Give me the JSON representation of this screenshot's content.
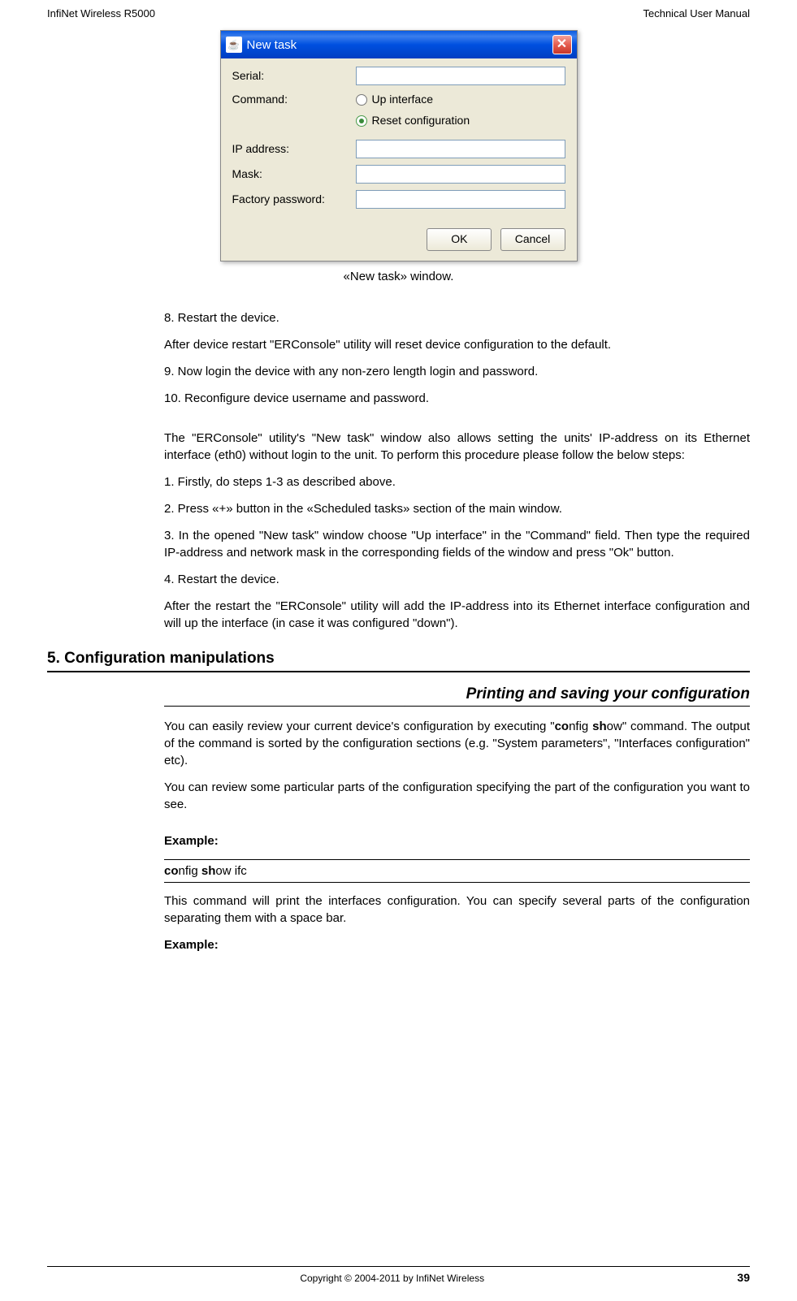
{
  "header": {
    "left": "InfiNet Wireless R5000",
    "right": "Technical User Manual"
  },
  "dialog": {
    "title": "New task",
    "serial_label": "Serial:",
    "command_label": "Command:",
    "up_interface": "Up interface",
    "reset_config": "Reset configuration",
    "ip_label": "IP address:",
    "mask_label": "Mask:",
    "factory_pw_label": "Factory password:",
    "ok": "OK",
    "cancel": "Cancel"
  },
  "caption": "«New task» window.",
  "body": {
    "p1": "8.  Restart the device.",
    "p2": "After device restart \"ERConsole\" utility will reset device configuration to the default.",
    "p3": "9.  Now login the device with any non-zero length login and password.",
    "p4": "10. Reconfigure device username and password.",
    "p5": "The \"ERConsole\" utility's \"New task\" window also allows setting the units' IP-address on its Ethernet interface (eth0) without login to the unit. To perform this procedure please follow the below steps:",
    "p6": "1. Firstly, do steps 1-3 as described above.",
    "p7": "2. Press «+» button in the «Scheduled tasks» section of the main window.",
    "p8": "3. In the opened \"New task\" window choose \"Up interface\" in the \"Command\" field. Then type the required IP-address and network mask in the corresponding fields of the window and press \"Ok\" button.",
    "p9": "4. Restart the device.",
    "p10": "After the restart the \"ERConsole\" utility will add the IP-address into its Ethernet interface configuration and will up the interface (in case it was configured \"down\")."
  },
  "section5": {
    "heading": "5. Configuration manipulations",
    "sub1": "Printing and saving your configuration",
    "p1a": "You can easily review your current device's configuration by executing \"",
    "p1b": "nfig ",
    "p1c": "ow\" command. The output of the command is sorted by the configuration sections (e.g. \"System parameters\", \"Interfaces configuration\" etc).",
    "p2": "You can review some particular parts of the configuration specifying the part of the configuration you want to see.",
    "example": "Example:",
    "code_co": "co",
    "code_nfig": "nfig ",
    "code_sh": "sh",
    "code_ow": "ow ifc",
    "p3": "This command will print the interfaces configuration. You can specify several parts of the configuration separating them with a space bar.",
    "example2": "Example:"
  },
  "footer": {
    "copyright": "Copyright © 2004-2011 by InfiNet Wireless",
    "page": "39"
  },
  "bold": {
    "co": "co",
    "sh": "sh"
  }
}
